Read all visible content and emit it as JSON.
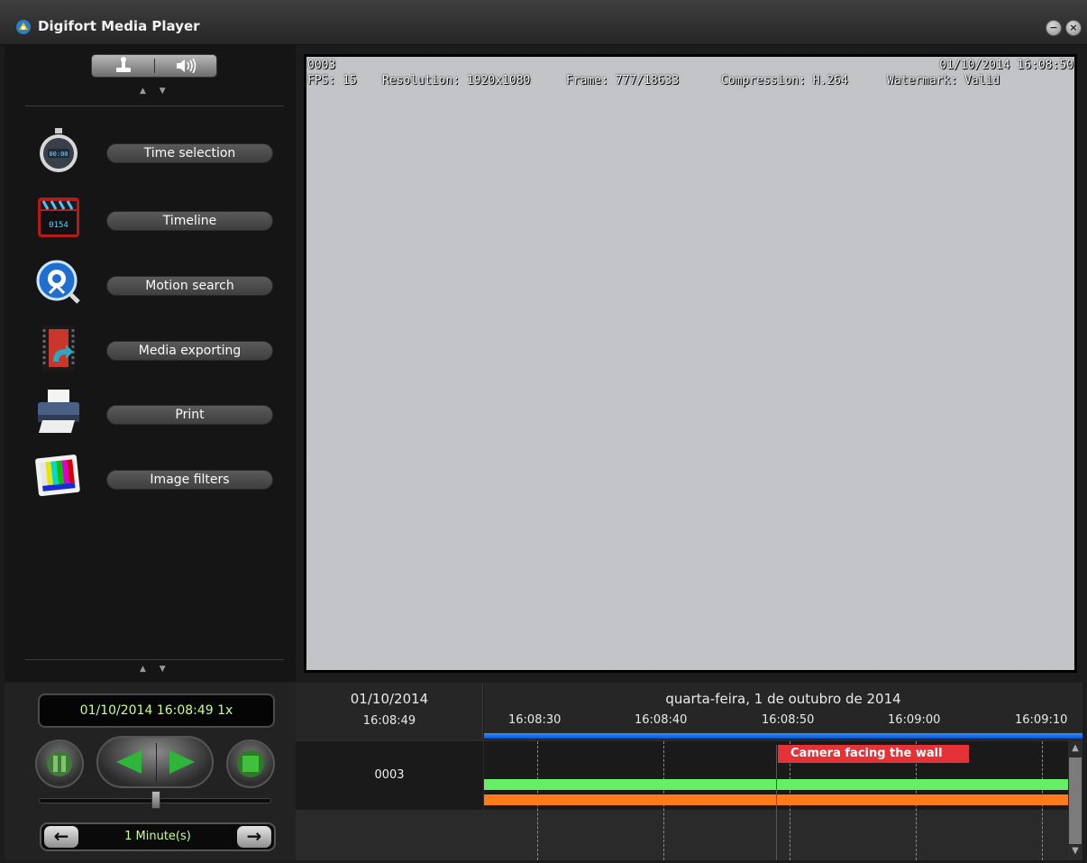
{
  "window": {
    "title": "Digifort Media Player",
    "buttons": {
      "minimize_glyph": "−",
      "close_glyph": "×"
    }
  },
  "left_panel": {
    "toggle": {
      "left_icon": "joystick-icon",
      "right_icon": "speaker-icon"
    },
    "scroll_arrows": "▲ ▼",
    "tools": [
      {
        "label": "Time selection",
        "icon": "stopwatch-icon"
      },
      {
        "label": "Timeline",
        "icon": "clapperboard-icon"
      },
      {
        "label": "Motion search",
        "icon": "motion-search-icon"
      },
      {
        "label": "Media exporting",
        "icon": "film-export-icon"
      },
      {
        "label": "Print",
        "icon": "printer-icon"
      },
      {
        "label": "Image filters",
        "icon": "image-filter-icon"
      }
    ]
  },
  "video": {
    "camera_id": "0003",
    "timestamp": "01/10/2014 16:08:50",
    "fps": "FPS: 15",
    "resolution": "Resolution: 1920x1080",
    "frame": "Frame: 777/18633",
    "compression": "Compression: H.264",
    "watermark": "Watermark: Valid"
  },
  "playback": {
    "clock": "01/10/2014 16:08:49 1x",
    "interval_label": "1 Minute(s)",
    "speed_position": 0.5
  },
  "timeline": {
    "date_short": "01/10/2014",
    "time_short": "16:08:49",
    "date_long": "quarta-feira, 1 de outubro de 2014",
    "ticks": [
      "16:08:30",
      "16:08:40",
      "16:08:50",
      "16:09:00",
      "16:09:10"
    ],
    "camera": "0003",
    "bookmark": "Camera facing the wall",
    "colors": {
      "recording": "#66ee66",
      "motion": "#ff7a1a",
      "bookmark": "#e43237",
      "cursor": "#e21b1b",
      "accent": "#1a6fe8"
    }
  }
}
